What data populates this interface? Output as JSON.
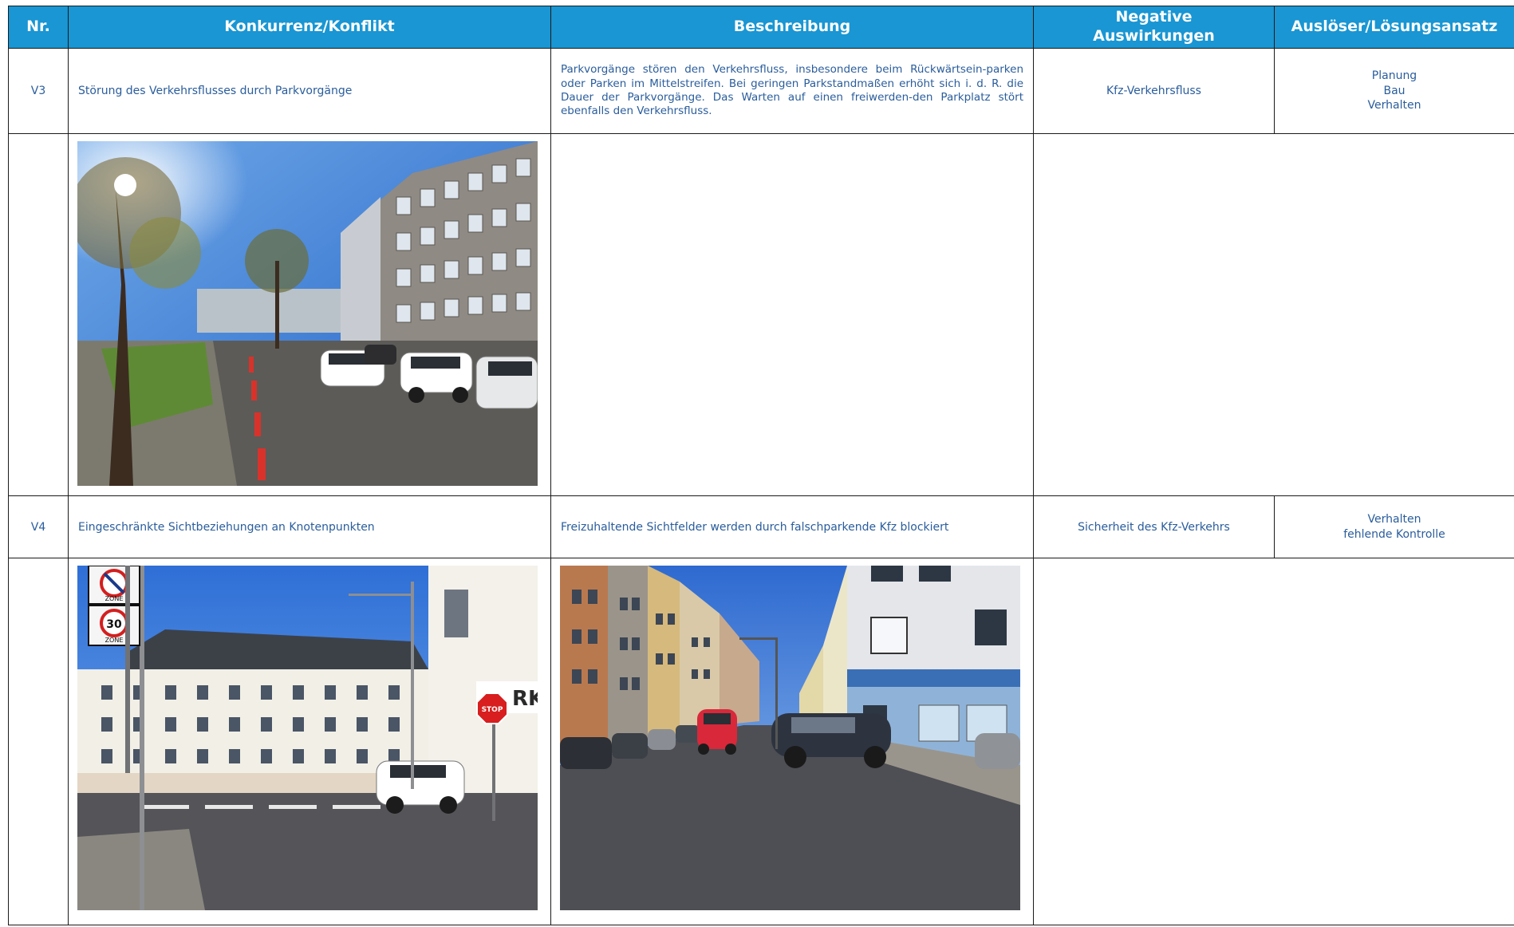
{
  "columns": {
    "nr": "Nr.",
    "konflikt": "Konkurrenz/Konflikt",
    "beschreibung": "Beschreibung",
    "negative_line1": "Negative",
    "negative_line2": "Auswirkungen",
    "ausloeser": "Auslöser/Lösungsansatz"
  },
  "rows": [
    {
      "nr": "V3",
      "konflikt": "Störung des Verkehrsflusses durch Parkvorgänge",
      "beschreibung": "Parkvorgänge stören den Verkehrsfluss, insbesondere beim Rückwärtsein-parken oder Parken im Mittelstreifen. Bei geringen Parkstandmaßen erhöht sich i. d. R. die Dauer der Parkvorgänge. Das Warten auf einen freiwerden-den Parkplatz stört ebenfalls den Verkehrsfluss.",
      "negative": "Kfz-Verkehrsfluss",
      "ausloeser": [
        "Planung",
        "Bau",
        "Verhalten"
      ]
    },
    {
      "nr": "V4",
      "konflikt": "Eingeschränkte Sichtbeziehungen an Knotenpunkten",
      "beschreibung": "Freizuhaltende Sichtfelder werden durch falschparkende Kfz blockiert",
      "negative": "Sicherheit des Kfz-Verkehrs",
      "ausloeser": [
        "Verhalten",
        "fehlende Kontrolle"
      ]
    }
  ],
  "photos": {
    "sign1": "ZONE",
    "sign2": "30",
    "sign3": "ZONE",
    "stop": "STOP",
    "shop": "RK"
  },
  "colors": {
    "header_bg": "#1996d3",
    "header_text": "#ffffff",
    "body_text": "#2a5d9c",
    "border": "#1a1a1a"
  }
}
